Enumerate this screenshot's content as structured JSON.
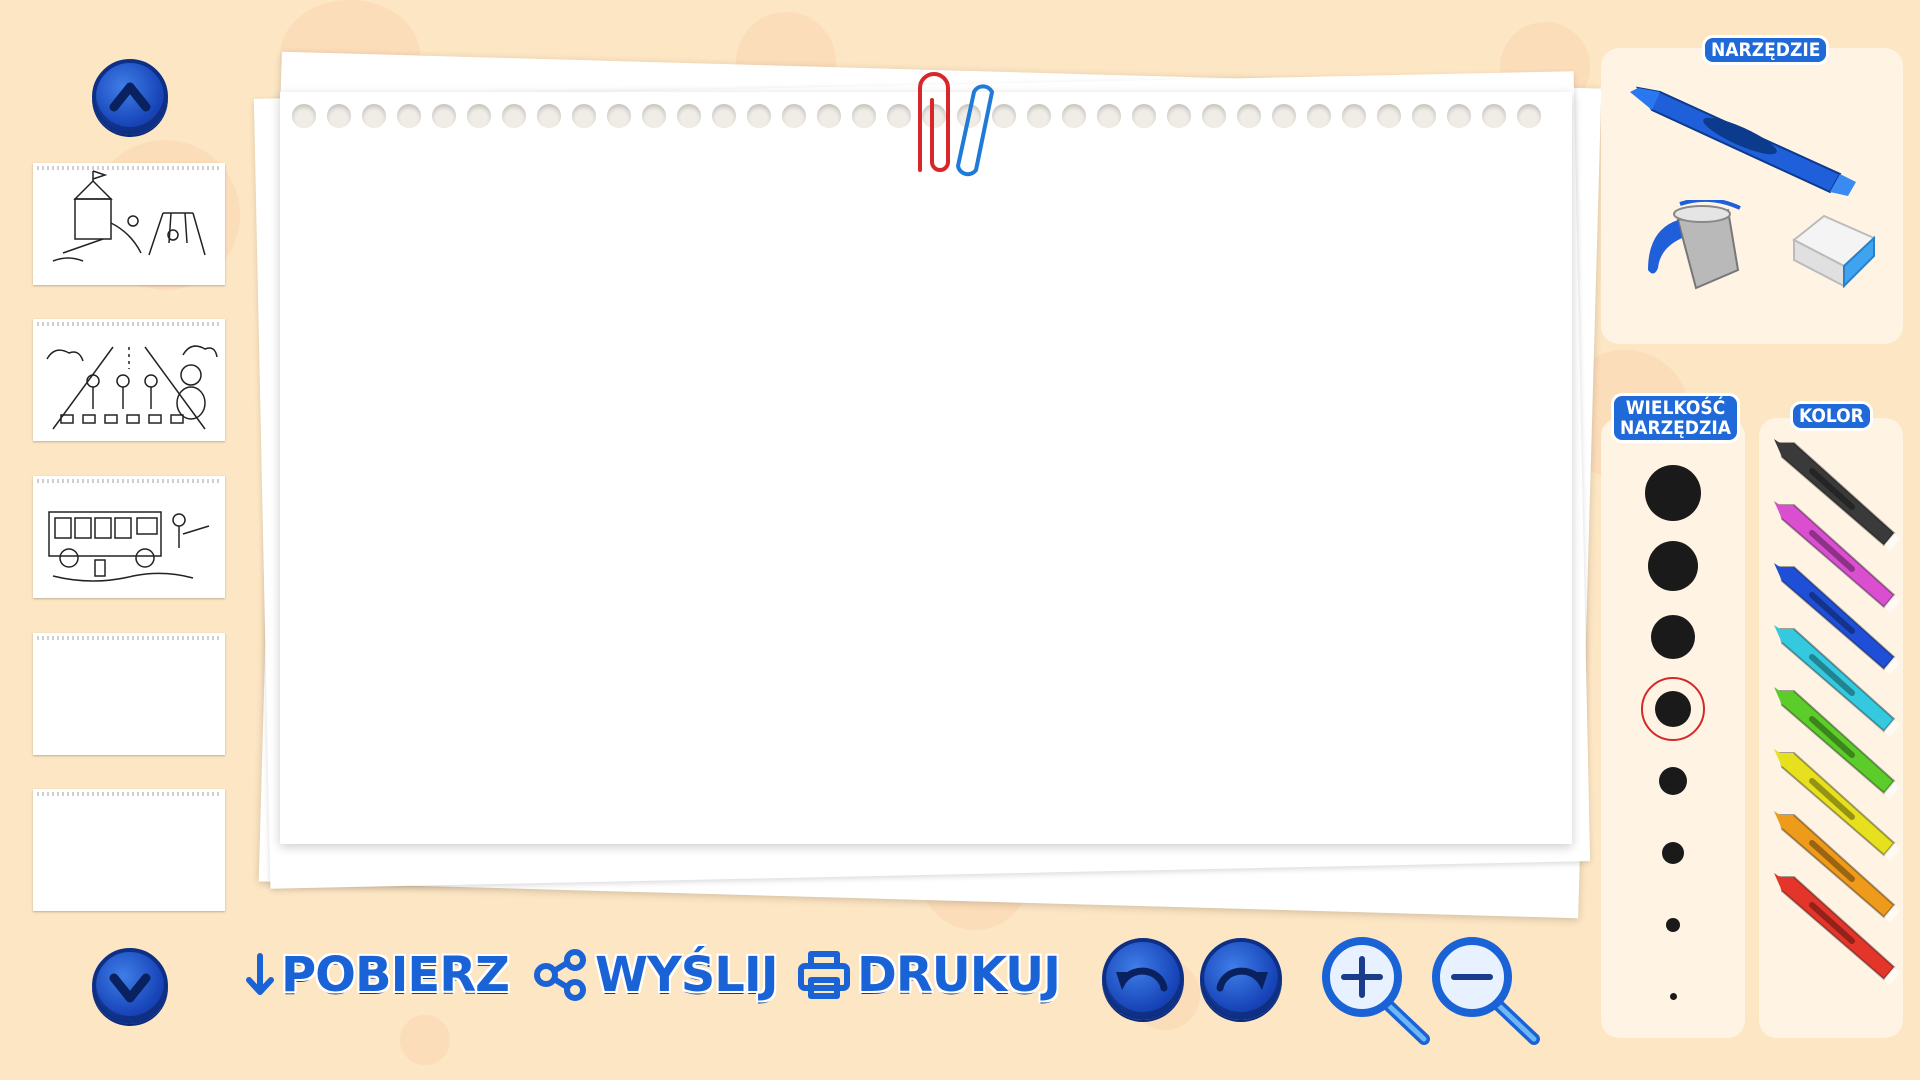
{
  "nav": {
    "up_label": "▲",
    "down_label": "▼"
  },
  "thumbnails": [
    {
      "name": "playground"
    },
    {
      "name": "crosswalk"
    },
    {
      "name": "firetruck"
    },
    {
      "name": "blank"
    },
    {
      "name": "blank"
    }
  ],
  "toolbar": {
    "download_label": "POBIERZ",
    "send_label": "WYŚLIJ",
    "print_label": "DRUKUJ"
  },
  "tools_panel": {
    "title": "NARZĘDZIE",
    "tools": [
      "crayon-tool-icon",
      "paint-bucket-icon",
      "eraser-icon"
    ]
  },
  "size_panel": {
    "title_line1": "WIELKOŚĆ",
    "title_line2": "NARZĘDZIA",
    "selected_index": 3
  },
  "color_panel": {
    "title": "KOLOR",
    "colors": [
      "#3a3a3a",
      "#d94fd0",
      "#1f4fd6",
      "#35c9df",
      "#5ccc2a",
      "#e6e01f",
      "#ee9a1a",
      "#e4352a"
    ]
  }
}
